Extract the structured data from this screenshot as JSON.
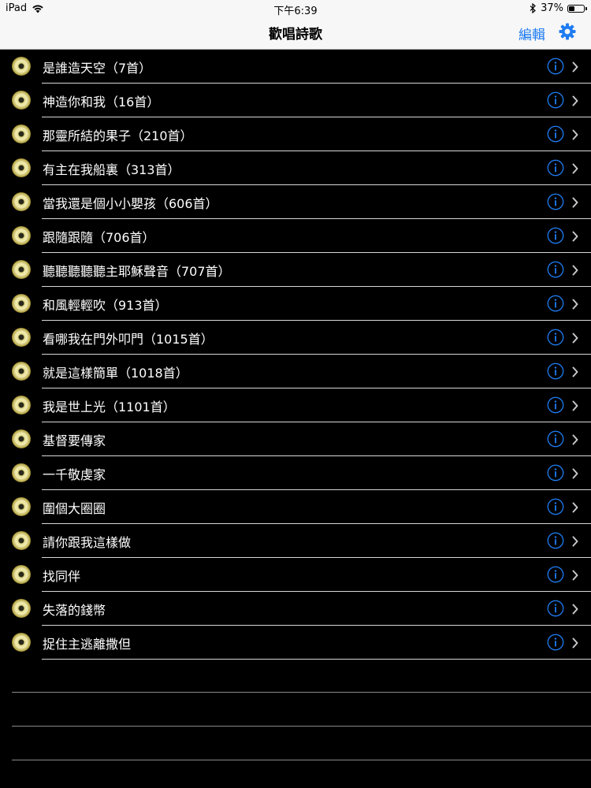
{
  "status": {
    "device": "iPad",
    "time": "下午6:39",
    "battery": "37%",
    "battery_level": 0.37
  },
  "nav": {
    "title": "歡唱詩歌",
    "edit_label": "編輯",
    "settings_icon": "gear-icon",
    "accent": "#1e7cf2"
  },
  "songs": [
    "是誰造天空（7首）",
    "神造你和我（16首）",
    "那靈所結的果子（210首）",
    "有主在我船裏（313首）",
    "當我還是個小小嬰孩（606首）",
    "跟隨跟隨（706首）",
    "聽聽聽聽聽主耶穌聲音（707首）",
    "和風輕輕吹（913首）",
    "看哪我在門外叩門（1015首）",
    "就是這樣簡單（1018首）",
    "我是世上光（1101首）",
    "基督要傳家",
    "一千敬虔家",
    "圍個大圈圈",
    "請你跟我這樣做",
    "找同伴",
    "失落的錢幣",
    "捉住主逃離撒但"
  ]
}
